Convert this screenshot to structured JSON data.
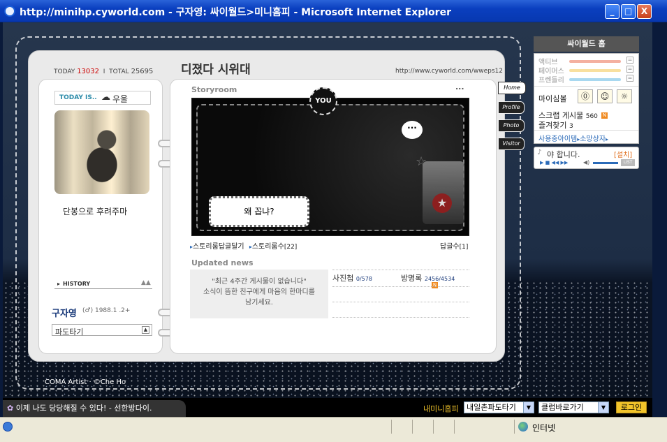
{
  "window": {
    "title": "http://minihp.cyworld.com - 구자영: 싸이월드>미니홈피 - Microsoft Internet Explorer",
    "min_label": "_",
    "max_label": "□",
    "close_label": "X"
  },
  "counter": {
    "today_label": "TODAY",
    "today_value": "13032",
    "separator": "I",
    "total_label": "TOTAL",
    "total_value": "25695"
  },
  "profile": {
    "today_is_label": "TODAY IS..",
    "mood": "우울",
    "message": "단봉으로 후려주마",
    "history_label": "HISTORY",
    "name": "구자영",
    "gender_glyph": "(♂)",
    "birth": "1988.1 .2+",
    "wave_select": "파도타기"
  },
  "header": {
    "home_title": "디졌다 시위대",
    "url": "http://www.cyworld.com/wweps12"
  },
  "storyroom": {
    "title": "Storyroom",
    "more": "...",
    "you_badge": "YOU",
    "speech_main": "왜 꼽냐?",
    "speech_dots": "···",
    "link_reply": "스토리룸답글달기",
    "link_count_label": "스토리룸수",
    "link_count_value": "[22]",
    "reply_count_label": "답글수",
    "reply_count_value": "[1]"
  },
  "updated": {
    "title": "Updated news",
    "empty_line1": "\"최근 4주간 게시물이 없습니다\"",
    "empty_line2": "소식이 뜸한 친구에게 마음의 한마디를",
    "empty_line3": "남기세요.",
    "photo_label": "사진첩",
    "photo_value": "0/578",
    "guest_label": "방명록",
    "guest_value": "2456/4534",
    "new_badge": "N"
  },
  "tabs": [
    {
      "label": "Home"
    },
    {
      "label": "Profile"
    },
    {
      "label": "Photo"
    },
    {
      "label": "Visitor"
    }
  ],
  "footer_credit": "COMA Artist · ©Che Ho",
  "sidebar": {
    "header": "싸이월드 홈",
    "stats": [
      {
        "label": "액티브",
        "color": "#f4b0a0"
      },
      {
        "label": "페이머스",
        "color": "#f8e0a0"
      },
      {
        "label": "프렌들리",
        "color": "#a8d8f0"
      }
    ],
    "stat_btn": "=",
    "mini_label": "마이심볼",
    "scrap_label": "스크랩 게시물",
    "scrap_value": "560",
    "fav_label": "즐겨찾기",
    "fav_value": "3",
    "items_link": "사용중아이템",
    "shop_link": "소망상자",
    "player_text": "야 합니다.",
    "player_setup": "[설치]",
    "player_list": "LIST"
  },
  "bottom": {
    "news_text": "이제 나도 당당해질 수 있다! - 선한방다이.",
    "my_home": "내미니홈피",
    "wave_select": "내일촌파도타기",
    "club_select": "클럽바로가기",
    "login": "로그인"
  },
  "statusbar": {
    "zone": "인터넷"
  }
}
